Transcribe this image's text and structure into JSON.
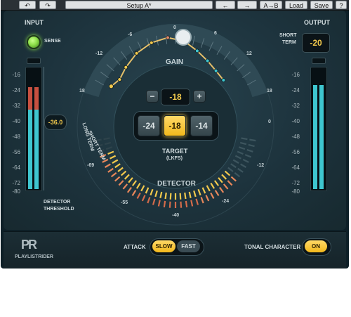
{
  "toolbar": {
    "undo": "↶",
    "redo": "↷",
    "preset_name": "Setup A*",
    "prev": "←",
    "next": "→",
    "ab": "A→B",
    "load": "Load",
    "save": "Save",
    "help": "?"
  },
  "input": {
    "title": "INPUT",
    "sense_label": "SENSE",
    "scale": [
      "-16",
      "-24",
      "-32",
      "-40",
      "-48",
      "-56",
      "-64",
      "-72",
      "-80"
    ],
    "threshold_value": "-36.0",
    "threshold_label_1": "DETECTOR",
    "threshold_label_2": "THRESHOLD"
  },
  "output": {
    "title": "OUTPUT",
    "short_term_1": "SHORT",
    "short_term_2": "TERM",
    "short_term_value": "-20",
    "scale": [
      "-16",
      "-24",
      "-32",
      "-40",
      "-48",
      "-56",
      "-64",
      "-72",
      "-80"
    ]
  },
  "gain": {
    "label": "GAIN",
    "scale": [
      "18",
      "-12",
      "-6",
      "0",
      "6",
      "12",
      "18"
    ]
  },
  "target": {
    "minus": "−",
    "value": "-18",
    "plus": "+",
    "presets": [
      "-24",
      "-18",
      "-14"
    ],
    "label": "TARGET",
    "units": "(LKFS)"
  },
  "detector": {
    "label": "DETECTOR",
    "short_term": "SHORT TERM",
    "long_term": "LONG TERM",
    "scale": [
      "0",
      "-12",
      "-24",
      "-40",
      "-55",
      "-69"
    ]
  },
  "bottom": {
    "logo": "PR",
    "brand": "PLAYLISTRIDER",
    "attack_label": "ATTACK",
    "attack_slow": "SLOW",
    "attack_fast": "FAST",
    "tonal_label": "TONAL CHARACTER",
    "tonal_value": "ON"
  },
  "colors": {
    "accent": "#f2c94c",
    "teal": "#3ec6cf",
    "red": "#c84a3c",
    "led": "#8ee04a"
  }
}
